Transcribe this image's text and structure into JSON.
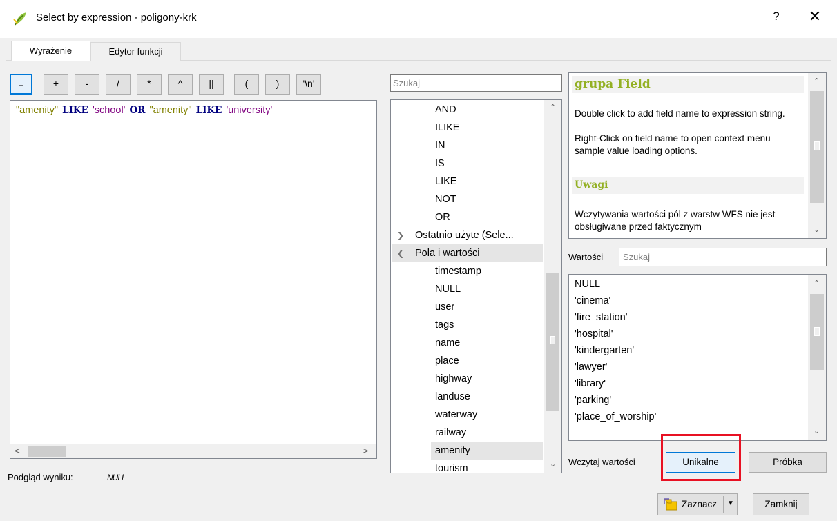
{
  "window": {
    "title": "Select by expression - poligony-krk",
    "help_label": "?",
    "close_label": "✕",
    "app_icon": "qgis-leaf-icon"
  },
  "tabs": [
    {
      "label": "Wyrażenie",
      "active": true
    },
    {
      "label": "Edytor funkcji",
      "active": false
    }
  ],
  "operators": [
    "=",
    "+",
    "-",
    "/",
    "*",
    "^",
    "||",
    "(",
    ")",
    "'\\n'"
  ],
  "expression": {
    "q1": "\"amenity\"",
    "k1": "LIKE",
    "s1": "'school'",
    "k2": "OR",
    "q2": "\"amenity\"",
    "k3": "LIKE",
    "s2": "'university'"
  },
  "preview": {
    "label": "Podgląd wyniku:",
    "value": "NULL"
  },
  "function_search": {
    "placeholder": "Szukaj"
  },
  "function_tree": {
    "operators": [
      "AND",
      "ILIKE",
      "IN",
      "IS",
      "LIKE",
      "NOT",
      "OR"
    ],
    "group_recent": "Ostatnio użyte (Sele...",
    "group_fields": "Pola i wartości",
    "fields": [
      "timestamp",
      "NULL",
      "user",
      "tags",
      "name",
      "place",
      "highway",
      "landuse",
      "waterway",
      "railway",
      "amenity",
      "tourism"
    ],
    "selected_field": "amenity"
  },
  "help": {
    "heading": "grupa Field",
    "para1": "Double click to add field name to expression string.",
    "para2": "Right-Click on field name to open context menu sample value loading options.",
    "notes_heading": "Uwagi",
    "notes_text": "Wczytywania wartości pól z warstw WFS nie jest obsługiwane przed faktycznym"
  },
  "values": {
    "label": "Wartości",
    "search_placeholder": "Szukaj",
    "items": [
      "NULL",
      "'cinema'",
      "'fire_station'",
      "'hospital'",
      "'kindergarten'",
      "'lawyer'",
      "'library'",
      "'parking'",
      "'place_of_worship'"
    ]
  },
  "load_values": {
    "label": "Wczytaj wartości",
    "unique_label": "Unikalne",
    "sample_label": "Próbka"
  },
  "footer": {
    "select_label": "Zaznacz",
    "close_label": "Zamknij"
  },
  "colors": {
    "accent": "#0078d7",
    "highlight": "#e81123",
    "help_heading": "#93b023",
    "keyword": "#00007f",
    "field": "#808000",
    "string": "#7f007f"
  }
}
